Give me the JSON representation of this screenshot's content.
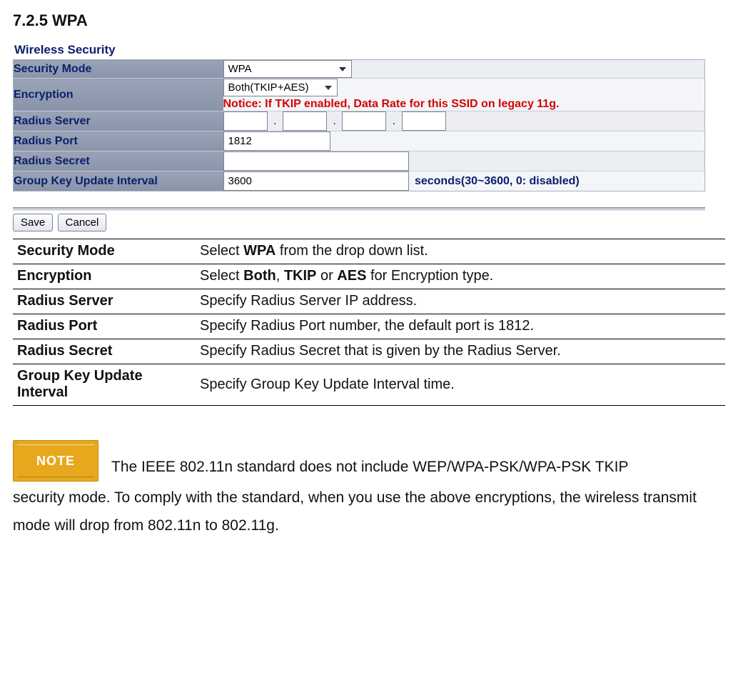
{
  "heading": "7.2.5 WPA",
  "panel_title": "Wireless Security",
  "form": {
    "security_mode": {
      "label": "Security Mode",
      "value": "WPA"
    },
    "encryption": {
      "label": "Encryption",
      "value": "Both(TKIP+AES)",
      "notice": "Notice: If TKIP enabled, Data Rate for this SSID on legacy 11g."
    },
    "radius_server": {
      "label": "Radius Server",
      "octets": [
        "",
        "",
        "",
        ""
      ]
    },
    "radius_port": {
      "label": "Radius Port",
      "value": "1812"
    },
    "radius_secret": {
      "label": "Radius Secret",
      "value": ""
    },
    "group_key": {
      "label": "Group Key Update Interval",
      "value": "3600",
      "hint": "seconds(30~3600, 0: disabled)"
    }
  },
  "buttons": {
    "save": "Save",
    "cancel": "Cancel"
  },
  "doc_rows": [
    {
      "label": "Security Mode",
      "desc_pre": "Select ",
      "strong1": "WPA",
      "desc_mid": " from the drop down list.",
      "strong2": "",
      "desc_mid2": "",
      "strong3": "",
      "desc_tail": ""
    },
    {
      "label": "Encryption",
      "desc_pre": "Select ",
      "strong1": "Both",
      "desc_mid": ", ",
      "strong2": "TKIP",
      "desc_mid2": " or ",
      "strong3": "AES",
      "desc_tail": " for Encryption type."
    },
    {
      "label": "Radius Server",
      "desc_pre": "Specify Radius Server IP address.",
      "strong1": "",
      "desc_mid": "",
      "strong2": "",
      "desc_mid2": "",
      "strong3": "",
      "desc_tail": ""
    },
    {
      "label": "Radius Port",
      "desc_pre": "Specify Radius Port number, the default port is 1812.",
      "strong1": "",
      "desc_mid": "",
      "strong2": "",
      "desc_mid2": "",
      "strong3": "",
      "desc_tail": ""
    },
    {
      "label": "Radius Secret",
      "desc_pre": "Specify Radius Secret that is given by the Radius Server.",
      "strong1": "",
      "desc_mid": "",
      "strong2": "",
      "desc_mid2": "",
      "strong3": "",
      "desc_tail": ""
    },
    {
      "label": "Group Key Update Interval",
      "desc_pre": "Specify Group Key Update Interval time.",
      "strong1": "",
      "desc_mid": "",
      "strong2": "",
      "desc_mid2": "",
      "strong3": "",
      "desc_tail": ""
    }
  ],
  "note": {
    "badge": "NOTE",
    "line1": "The IEEE 802.11n standard does not include WEP/WPA-PSK/WPA-PSK TKIP",
    "rest": "security mode. To comply with the standard, when you use the above encryptions, the wireless transmit mode will drop from 802.11n to 802.11g."
  }
}
